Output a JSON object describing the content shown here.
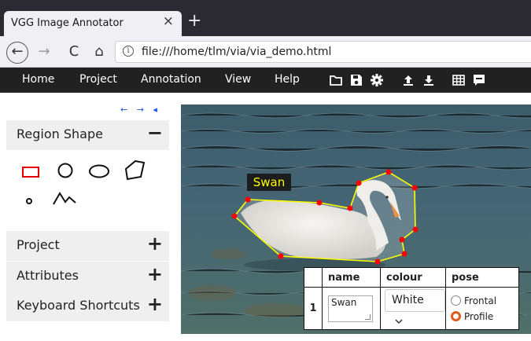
{
  "browser": {
    "tab_title": "VGG Image Annotator",
    "tab_close": "×",
    "new_tab": "+",
    "back": "←",
    "forward": "→",
    "reload": "C",
    "home": "⌂",
    "info": "i",
    "url": "file:///home/tlm/via/via_demo.html"
  },
  "menu": {
    "items": [
      "Home",
      "Project",
      "Annotation",
      "View",
      "Help"
    ],
    "tools": [
      "folder-icon",
      "save-icon",
      "settings-icon",
      "upload-icon",
      "download-icon",
      "grid-icon",
      "comment-icon"
    ]
  },
  "left_panel": {
    "arrows": "← → ◂",
    "region_shape": {
      "title": "Region Shape",
      "toggle": "−"
    },
    "shapes": [
      "rectangle",
      "circle",
      "ellipse",
      "polygon",
      "point",
      "polyline"
    ],
    "project": {
      "title": "Project",
      "toggle": "+"
    },
    "attributes": {
      "title": "Attributes",
      "toggle": "+"
    },
    "shortcuts": {
      "title": "Keyboard Shortcuts",
      "toggle": "+"
    }
  },
  "region": {
    "label": "Swan",
    "stroke_color": "#ffff00",
    "vertex_color": "#ff0000"
  },
  "table": {
    "headers": [
      "",
      "name",
      "colour",
      "pose"
    ],
    "rows": [
      {
        "index": "1",
        "name": "Swan",
        "colour": "White",
        "pose_options": [
          {
            "label": "Frontal",
            "selected": false
          },
          {
            "label": "Profile",
            "selected": true
          }
        ]
      }
    ]
  },
  "colors": {
    "menubar": "#212121",
    "accent": "#e05a1c",
    "link_blue": "#1a56e8"
  }
}
